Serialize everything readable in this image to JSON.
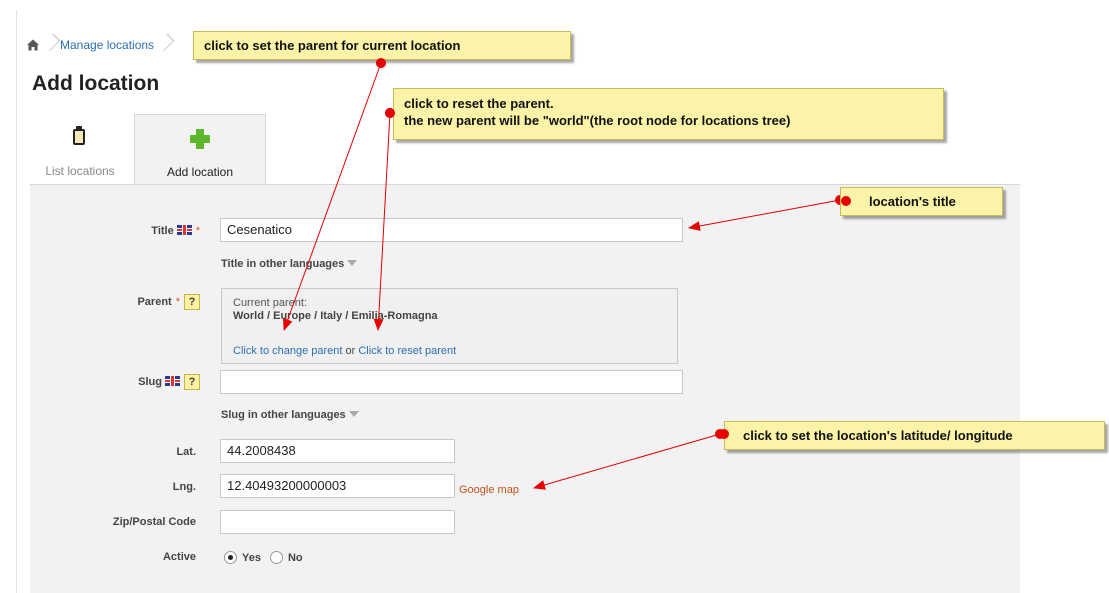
{
  "breadcrumb": {
    "home_icon": "home-icon",
    "manage_locations": "Manage locations"
  },
  "page_title": "Add location",
  "tabs": [
    {
      "label": "List locations",
      "icon": "clipboard-icon",
      "active": false
    },
    {
      "label": "Add location",
      "icon": "plus-icon",
      "active": true
    }
  ],
  "form": {
    "title": {
      "label": "Title",
      "required_mark": "*",
      "value": "Cesenatico",
      "other_languages": "Title in other languages"
    },
    "parent": {
      "label": "Parent",
      "required_mark": "*",
      "help": "?",
      "current_label": "Current parent:",
      "current_path": "World / Europe / Italy / Emilia-Romagna",
      "change_link": "Click to change parent",
      "or_text": " or ",
      "reset_link": "Click to reset parent"
    },
    "slug": {
      "label": "Slug",
      "help": "?",
      "value": "",
      "other_languages": "Slug in other languages"
    },
    "lat": {
      "label": "Lat.",
      "value": "44.2008438"
    },
    "lng": {
      "label": "Lng.",
      "value": "12.40493200000003",
      "map_link": "Google map"
    },
    "zip": {
      "label": "Zip/Postal Code",
      "value": ""
    },
    "active": {
      "label": "Active",
      "yes": "Yes",
      "no": "No",
      "selected": "Yes"
    }
  },
  "annotations": {
    "set_parent": "click to set the parent for current location",
    "reset_parent_line1": "click to reset the parent.",
    "reset_parent_line2": "the new parent will be \"world\"(the root node for locations tree)",
    "title_note": "location's title",
    "latlng_note": "click to set the location's latitude/ longitude"
  },
  "colors": {
    "link": "#2a6fb3",
    "map_link": "#c0541c",
    "required": "#e4552b",
    "note_bg": "#fbf4a8",
    "arrow": "#e60000"
  }
}
